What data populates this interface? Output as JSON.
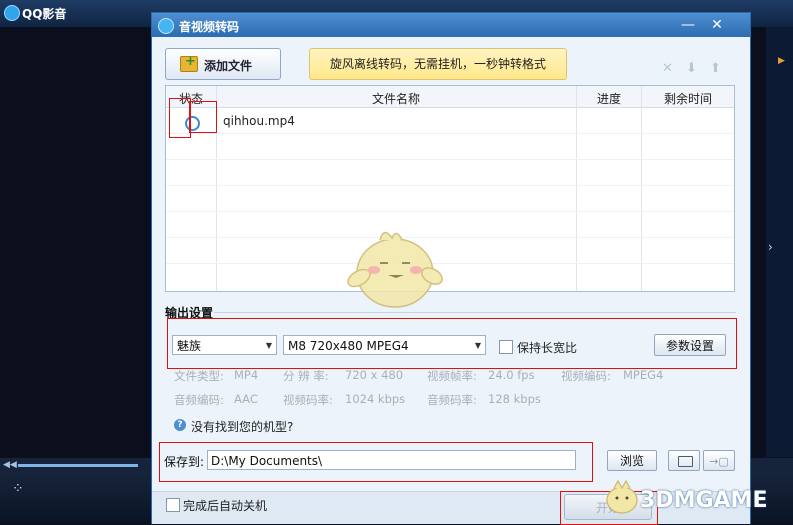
{
  "player": {
    "title": "QQ影音"
  },
  "dialog": {
    "title": "音视频转码",
    "add_file_label": "添加文件",
    "promo_text": "旋风离线转码，无需挂机，一秒钟转格式",
    "table": {
      "headers": [
        "状态",
        "文件名称",
        "进度",
        "剩余时间"
      ],
      "rows": [
        {
          "name": "qihhou.mp4",
          "progress": "",
          "remaining": ""
        }
      ]
    },
    "output": {
      "section_title": "输出设置",
      "brand_selected": "魅族",
      "model_selected": "M8 720x480 MPEG4",
      "keep_ratio_label": "保持长宽比",
      "params_button": "参数设置",
      "info": {
        "file_type_label": "文件类型:",
        "file_type_value": "MP4",
        "resolution_label": "分 辨 率:",
        "resolution_value": "720 x 480",
        "frame_rate_label": "视频帧率:",
        "frame_rate_value": "24.0 fps",
        "video_codec_label": "视频编码:",
        "video_codec_value": "MPEG4",
        "audio_codec_label": "音频编码:",
        "audio_codec_value": "AAC",
        "video_bitrate_label": "视频码率:",
        "video_bitrate_value": "1024 kbps",
        "audio_bitrate_label": "音频码率:",
        "audio_bitrate_value": "128 kbps"
      },
      "help_text": "没有找到您的机型?"
    },
    "save": {
      "label": "保存到:",
      "path": "D:\\My Documents\\",
      "browse_button": "浏览"
    },
    "bottom": {
      "shutdown_label": "完成后自动关机",
      "start_button": "开始"
    }
  },
  "watermark": "3DMGAME",
  "colors": {
    "dialog_title_bar": "#2b6cb2",
    "dialog_body": "#ecf3fb",
    "highlight_box": "#e01010",
    "promo_background": "#ffe88a"
  }
}
